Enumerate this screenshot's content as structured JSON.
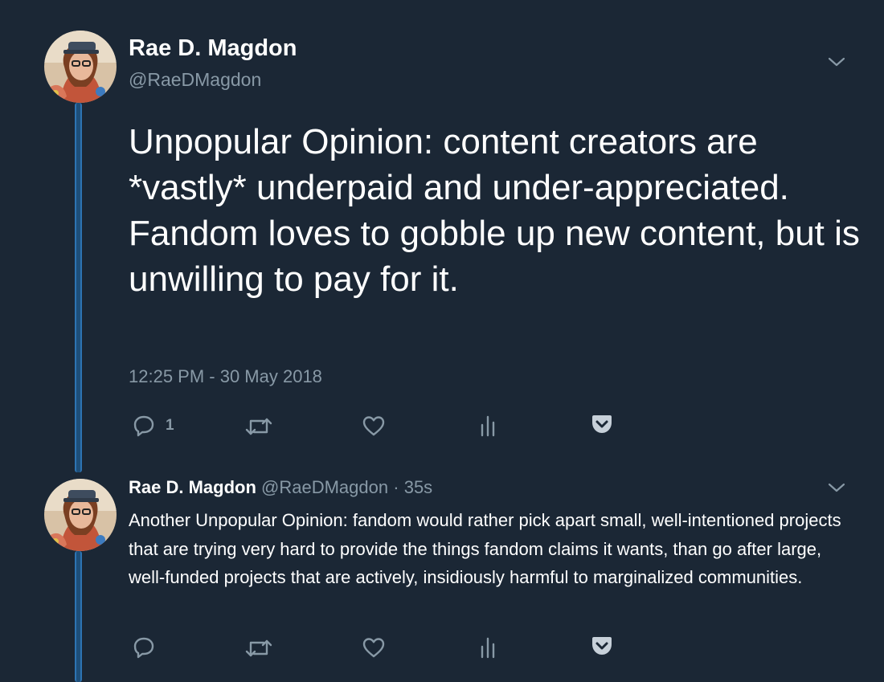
{
  "tweet": {
    "author_name": "Rae D. Magdon",
    "author_handle": "@RaeDMagdon",
    "text": "Unpopular Opinion: content creators are *vastly* underpaid and under-appreciated. Fandom loves to gobble up new content, but is unwilling to pay for it.",
    "timestamp": "12:25 PM - 30 May 2018",
    "reply_count": "1",
    "icons": [
      "reply-icon",
      "retweet-icon",
      "like-icon",
      "analytics-icon",
      "pocket-icon",
      "chevron-down-icon"
    ]
  },
  "reply": {
    "author_name": "Rae D. Magdon",
    "author_handle": "@RaeDMagdon",
    "separator": "·",
    "time_ago": "35s",
    "text": "Another Unpopular Opinion: fandom would rather pick apart small, well-intentioned projects that are trying very hard to provide the things fandom claims it wants, than go after large, well-funded projects that are actively, insidiously harmful to marginalized communities."
  },
  "colors": {
    "background": "#1b2735",
    "text": "#ffffff",
    "secondary_text": "#8899a6",
    "thread_line": "#2d74b3"
  }
}
